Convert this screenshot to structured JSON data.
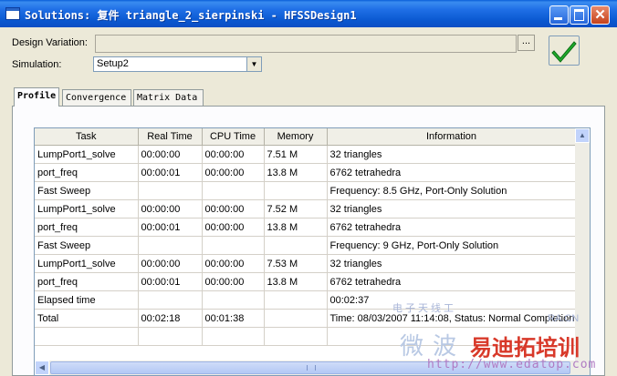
{
  "window": {
    "title": "Solutions: 复件 triangle_2_sierpinski - HFSSDesign1",
    "close_glyph": "✕"
  },
  "form": {
    "design_variation_label": "Design Variation:",
    "design_variation_value": "",
    "browse_label": "...",
    "simulation_label": "Simulation:",
    "simulation_value": "Setup2"
  },
  "tabs": [
    {
      "label": "Profile",
      "active": true
    },
    {
      "label": "Convergence",
      "active": false
    },
    {
      "label": "Matrix Data",
      "active": false
    }
  ],
  "table": {
    "columns": [
      "Task",
      "Real Time",
      "CPU Time",
      "Memory",
      "Information"
    ],
    "rows": [
      [
        "LumpPort1_solve",
        "00:00:00",
        "00:00:00",
        "7.51 M",
        "32 triangles"
      ],
      [
        "port_freq",
        "00:00:01",
        "00:00:00",
        "13.8 M",
        "6762 tetrahedra"
      ],
      [
        "Fast Sweep",
        "",
        "",
        "",
        "Frequency: 8.5  GHz,  Port-Only Solution"
      ],
      [
        "LumpPort1_solve",
        "00:00:00",
        "00:00:00",
        "7.52 M",
        "32 triangles"
      ],
      [
        "port_freq",
        "00:00:01",
        "00:00:00",
        "13.8 M",
        "6762 tetrahedra"
      ],
      [
        "Fast Sweep",
        "",
        "",
        "",
        "Frequency: 9  GHz,  Port-Only Solution"
      ],
      [
        "LumpPort1_solve",
        "00:00:00",
        "00:00:00",
        "7.53 M",
        "32 triangles"
      ],
      [
        "port_freq",
        "00:00:01",
        "00:00:00",
        "13.8 M",
        "6762 tetrahedra"
      ],
      [
        "Elapsed time",
        "",
        "",
        "",
        "00:02:37"
      ],
      [
        "Total",
        "00:02:18",
        "00:01:38",
        "",
        "Time:  08/03/2007 11:14:08, Status: Normal Completion"
      ],
      [
        "",
        "",
        "",
        "",
        ""
      ]
    ]
  },
  "watermark": {
    "line1": "电子天线工",
    "line2": "RA.CN",
    "line3": "微波",
    "line4": "易迪拓培训",
    "line5": "http://www.edatop.com"
  },
  "colors": {
    "title_bar": "#0a58d0",
    "check_green": "#1fae2c",
    "watermark_red": "#d8392a"
  },
  "icons": {
    "ok": "check-mark-icon",
    "scroll_up": "arrow-up-icon",
    "scroll_left": "arrow-left-icon",
    "dropdown": "chevron-down-icon"
  }
}
